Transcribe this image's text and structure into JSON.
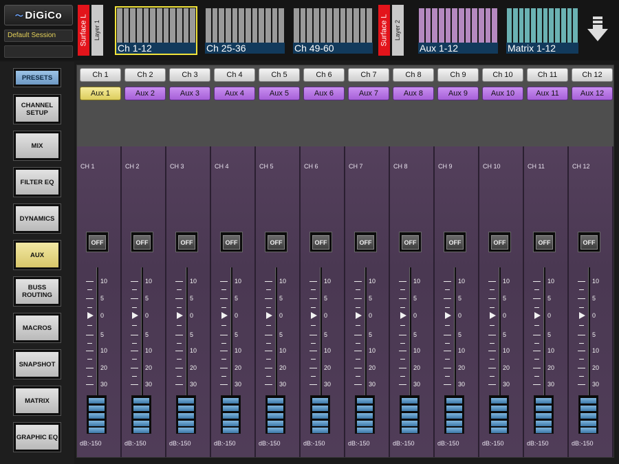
{
  "header": {
    "logo_text": "DiGiCo",
    "session_name": "Default Session",
    "surface_left_label": "Surface L",
    "layer1_label": "Layer 1",
    "surface_right_label": "Surface L",
    "layer2_label": "Layer 2",
    "banks": [
      {
        "label": "Ch 1-12",
        "color": "#9a9a9a",
        "selected": true
      },
      {
        "label": "Ch 25-36",
        "color": "#9a9a9a",
        "selected": false
      },
      {
        "label": "Ch 49-60",
        "color": "#9a9a9a",
        "selected": false
      },
      {
        "label": "Aux 1-12",
        "color": "#b589c0",
        "selected": false
      },
      {
        "label": "Matrix 1-12",
        "color": "#6bb2b3",
        "selected": false
      }
    ],
    "scroll_icon": "arrow-down-icon"
  },
  "menu": {
    "items": [
      {
        "label": "PRESETS",
        "style": "presets"
      },
      {
        "label": "CHANNEL SETUP",
        "style": ""
      },
      {
        "label": "MIX",
        "style": ""
      },
      {
        "label": "FILTER EQ",
        "style": ""
      },
      {
        "label": "DYNAMICS",
        "style": ""
      },
      {
        "label": "AUX",
        "style": "aux"
      },
      {
        "label": "BUSS ROUTING",
        "style": ""
      },
      {
        "label": "MACROS",
        "style": ""
      },
      {
        "label": "SNAPSHOT",
        "style": ""
      },
      {
        "label": "MATRIX",
        "style": ""
      },
      {
        "label": "GRAPHIC EQ",
        "style": ""
      }
    ]
  },
  "channel_buttons": [
    "Ch 1",
    "Ch 2",
    "Ch 3",
    "Ch 4",
    "Ch 5",
    "Ch 6",
    "Ch 7",
    "Ch 8",
    "Ch 9",
    "Ch 10",
    "Ch 11",
    "Ch 12"
  ],
  "aux_buttons": [
    "Aux 1",
    "Aux 2",
    "Aux 3",
    "Aux 4",
    "Aux 5",
    "Aux 6",
    "Aux 7",
    "Aux 8",
    "Aux 9",
    "Aux 10",
    "Aux 11",
    "Aux 12"
  ],
  "active_aux_index": 0,
  "fader_scale": [
    "10",
    "5",
    "0",
    "5",
    "10",
    "20",
    "30"
  ],
  "strips": [
    {
      "name": "CH 1",
      "off_label": "OFF",
      "db_label": "dB:-150"
    },
    {
      "name": "CH 2",
      "off_label": "OFF",
      "db_label": "dB:-150"
    },
    {
      "name": "CH 3",
      "off_label": "OFF",
      "db_label": "dB:-150"
    },
    {
      "name": "CH 4",
      "off_label": "OFF",
      "db_label": "dB:-150"
    },
    {
      "name": "CH 5",
      "off_label": "OFF",
      "db_label": "dB:-150"
    },
    {
      "name": "CH 6",
      "off_label": "OFF",
      "db_label": "dB:-150"
    },
    {
      "name": "CH 7",
      "off_label": "OFF",
      "db_label": "dB:-150"
    },
    {
      "name": "CH 8",
      "off_label": "OFF",
      "db_label": "dB:-150"
    },
    {
      "name": "CH 9",
      "off_label": "OFF",
      "db_label": "dB:-150"
    },
    {
      "name": "CH 10",
      "off_label": "OFF",
      "db_label": "dB:-150"
    },
    {
      "name": "CH 11",
      "off_label": "OFF",
      "db_label": "dB:-150"
    },
    {
      "name": "CH 12",
      "off_label": "OFF",
      "db_label": "dB:-150"
    }
  ],
  "colors": {
    "strip_bg": "#4a3852",
    "aux_active": "#dccd5c",
    "aux_inactive": "#a660d8",
    "bank_label_bg": "#123a5c"
  }
}
